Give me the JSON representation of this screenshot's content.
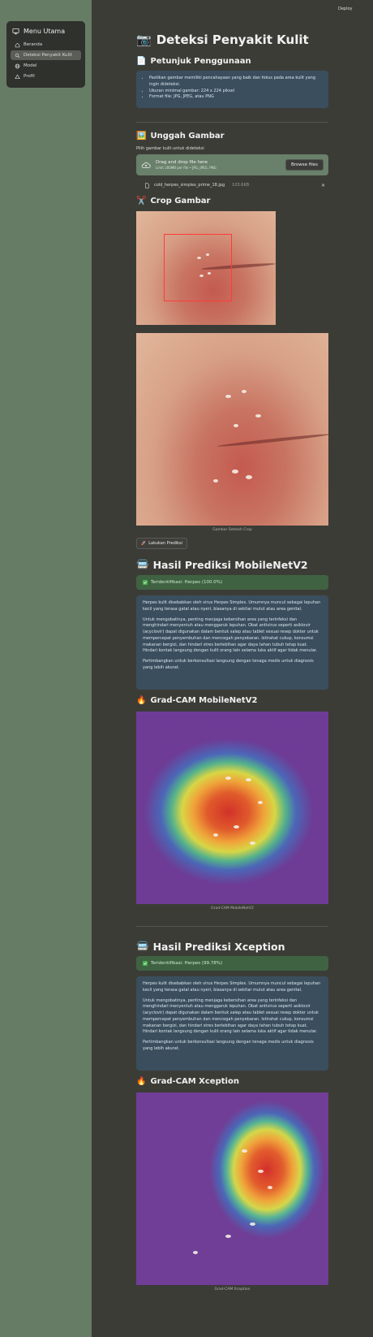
{
  "header": {
    "deploy_label": "Deploy"
  },
  "sidebar": {
    "title": "Menu Utama",
    "items": [
      {
        "label": "Beranda",
        "icon": "house-icon",
        "active": false
      },
      {
        "label": "Deteksi Penyakit Kulit",
        "icon": "search-icon",
        "active": true
      },
      {
        "label": "Model",
        "icon": "globe-icon",
        "active": false
      },
      {
        "label": "Profil",
        "icon": "triangle-icon",
        "active": false
      }
    ]
  },
  "page": {
    "title": "Deteksi Penyakit Kulit",
    "title_icon": "📷",
    "instructions": {
      "heading": "Petunjuk Penggunaan",
      "icon": "📄",
      "items": [
        "Pastikan gambar memiliki pencahayaan yang baik dan fokus pada area kulit yang ingin dideteksi.",
        "Ukuran minimal gambar: 224 x 224 piksel",
        "Format file: JPG, JPEG, atau PNG"
      ]
    },
    "upload": {
      "heading": "Unggah Gambar",
      "icon": "🖼️",
      "label": "Pilih gambar kulit untuk dideteksi",
      "drop_text": "Drag and drop file here",
      "limit_text": "Limit 200MB per file • JPG, JPEG, PNG",
      "browse_label": "Browse files",
      "file_name": "cold_herpes_simplex_prime_18.jpg",
      "file_size": "103.6KB"
    },
    "crop": {
      "heading": "Crop Gambar",
      "icon": "✂️",
      "result_caption": "Gambar Setelah Crop",
      "button_label": "Lakukan Prediksi",
      "button_icon": "🚀"
    },
    "mobilenet": {
      "heading": "Hasil Prediksi MobileNetV2",
      "icon": "🚍",
      "result": "Teridentifikasi: Herpes (100.0%)",
      "paragraphs": [
        "Herpes kulit disebabkan oleh virus Herpes Simplex. Umumnya muncul sebagai lepuhan kecil yang terasa gatal atau nyeri, biasanya di sekitar mulut atau area genital.",
        "Untuk mengobatinya, penting menjaga kebersihan area yang terinfeksi dan menghindari menyentuh atau menggaruk lepuhan. Obat antivirus seperti asiklovir (acyclovir) dapat digunakan dalam bentuk salep atau tablet sesuai resep dokter untuk mempercepat penyembuhan dan mencegah penyebaran. Istirahat cukup, konsumsi makanan bergizi, dan hindari stres berlebihan agar daya tahan tubuh tetap kuat. Hindari kontak langsung dengan kulit orang lain selama luka aktif agar tidak menular.",
        "Pertimbangkan untuk berkonsultasi langsung dengan tenaga medis untuk diagnosis yang lebih akurat."
      ],
      "gradcam_heading": "Grad-CAM MobileNetV2",
      "gradcam_icon": "🔥",
      "gradcam_caption": "Grad-CAM MobileNetV2"
    },
    "xception": {
      "heading": "Hasil Prediksi Xception",
      "icon": "🚍",
      "result": "Teridentifikasi: Herpes (99.78%)",
      "paragraphs": [
        "Herpes kulit disebabkan oleh virus Herpes Simplex. Umumnya muncul sebagai lepuhan kecil yang terasa gatal atau nyeri, biasanya di sekitar mulut atau area genital.",
        "Untuk mengobatinya, penting menjaga kebersihan area yang terinfeksi dan menghindari menyentuh atau menggaruk lepuhan. Obat antivirus seperti asiklovir (acyclovir) dapat digunakan dalam bentuk salep atau tablet sesuai resep dokter untuk mempercepat penyembuhan dan mencegah penyebaran. Istirahat cukup, konsumsi makanan bergizi, dan hindari stres berlebihan agar daya tahan tubuh tetap kuat. Hindari kontak langsung dengan kulit orang lain selama luka aktif agar tidak menular.",
        "Pertimbangkan untuk berkonsultasi langsung dengan tenaga medis untuk diagnosis yang lebih akurat."
      ],
      "gradcam_heading": "Grad-CAM Xception",
      "gradcam_icon": "🔥",
      "gradcam_caption": "Grad-CAM Xception"
    }
  },
  "colors": {
    "sidebar_bg": "#677c65",
    "main_bg": "#3c3c37",
    "info_bg": "#3a4e5d",
    "success_bg": "#3f6342",
    "crop_rect": "#ff3b3b"
  }
}
